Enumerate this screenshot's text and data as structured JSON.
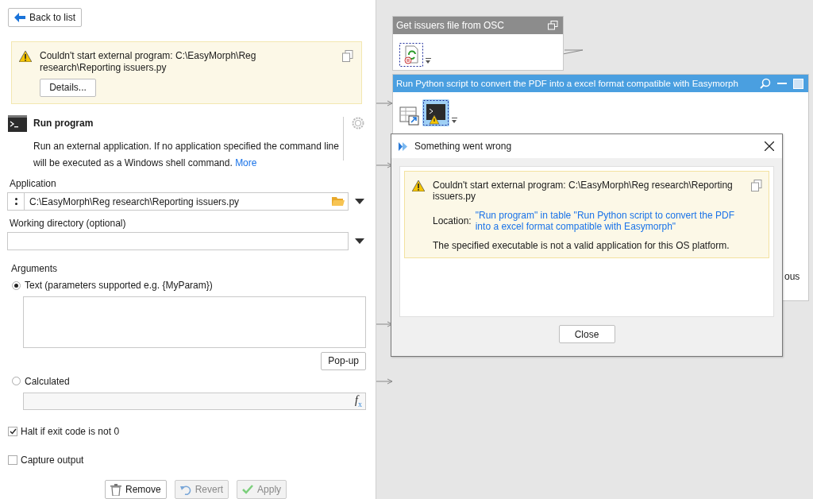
{
  "back_button": "Back to list",
  "alert": {
    "message": "Couldn't start external program: C:\\EasyMorph\\Reg research\\Reporting issuers.py",
    "details_button": "Details..."
  },
  "action": {
    "title": "Run program",
    "description": "Run an external application. If no application specified the command line will be executed as a Windows shell command.",
    "more_link": "More"
  },
  "application": {
    "label": "Application",
    "value": "C:\\EasyMorph\\Reg research\\Reporting issuers.py"
  },
  "working_directory": {
    "label": "Working directory (optional)"
  },
  "arguments": {
    "label": "Arguments",
    "options": [
      {
        "label": "Text (parameters supported e.g. {MyParam})",
        "selected": true
      },
      {
        "label": "Calculated",
        "selected": false
      }
    ],
    "popup_button": "Pop-up",
    "formula_button": {
      "symbol": "f",
      "subscript": "x"
    }
  },
  "checkboxes": [
    {
      "label": "Halt if exit code is not 0",
      "checked": true
    },
    {
      "label": "Capture output",
      "checked": false
    }
  ],
  "buttons": [
    {
      "kind": "remove",
      "label": "Remove",
      "disabled": false
    },
    {
      "kind": "revert",
      "label": "Revert",
      "disabled": true
    },
    {
      "kind": "apply",
      "label": "Apply",
      "disabled": true
    }
  ],
  "canvas": {
    "tables": [
      {
        "title": "Get issuers file from OSC",
        "selected": false
      },
      {
        "title": "Run Python script to convert the PDF into a excel format compatible with Easymorph",
        "selected": true
      }
    ],
    "partial_text": "ous"
  },
  "dialog": {
    "title": "Something went wrong",
    "message": "Couldn't start external program: C:\\EasyMorph\\Reg research\\Reporting issuers.py",
    "location_label": "Location:",
    "location": "\"Run program\" in table \"Run Python script to convert the PDF into a excel format compatible with Easymorph\"",
    "detail": "The specified executable is not a valid application for this OS platform.",
    "close_button": "Close"
  }
}
